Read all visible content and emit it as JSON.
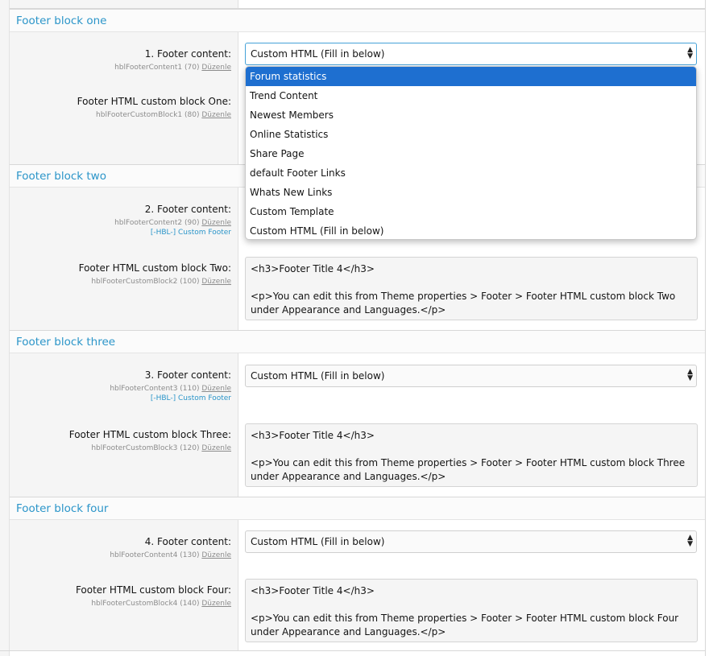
{
  "blocks": [
    {
      "title": "Footer block one",
      "content_label": "1. Footer content:",
      "content_var": "hblFooterContent1 (70)",
      "custom_label": "Footer HTML custom block One:",
      "custom_var": "hblFooterCustomBlock1 (80)",
      "select_value": "Custom HTML (Fill in below)"
    },
    {
      "title": "Footer block two",
      "content_label": "2. Footer content:",
      "content_var": "hblFooterContent2 (90)",
      "content_link": "[-HBL-] Custom Footer",
      "custom_label": "Footer HTML custom block Two:",
      "custom_var": "hblFooterCustomBlock2 (100)",
      "textarea": "<h3>Footer Title 4</h3>\n\n<p>You can edit this from Theme properties > Footer > Footer HTML custom block Two under Appearance and Languages.</p>"
    },
    {
      "title": "Footer block three",
      "content_label": "3. Footer content:",
      "content_var": "hblFooterContent3 (110)",
      "content_link": "[-HBL-] Custom Footer",
      "custom_label": "Footer HTML custom block Three:",
      "custom_var": "hblFooterCustomBlock3 (120)",
      "select_value": "Custom HTML (Fill in below)",
      "textarea": "<h3>Footer Title 4</h3>\n\n<p>You can edit this from Theme properties > Footer > Footer HTML custom block Three under Appearance and Languages.</p>"
    },
    {
      "title": "Footer block four",
      "content_label": "4. Footer content:",
      "content_var": "hblFooterContent4 (130)",
      "custom_label": "Footer HTML custom block Four:",
      "custom_var": "hblFooterCustomBlock4 (140)",
      "select_value": "Custom HTML (Fill in below)",
      "textarea": "<h3>Footer Title 4</h3>\n\n<p>You can edit this from Theme properties > Footer > Footer HTML custom block Four under Appearance and Languages.</p>"
    }
  ],
  "edit_link": "Düzenle",
  "dropdown_options": [
    "Forum statistics",
    "Trend Content",
    "Newest Members",
    "Online Statistics",
    "Share Page",
    "default Footer Links",
    "Whats New Links",
    "Custom Template",
    "Custom HTML (Fill in below)"
  ],
  "dropdown_highlighted": "Forum statistics",
  "colors": {
    "accent": "#2b95c9",
    "highlight": "#1e6fd0",
    "label_bg": "#f5f5f5"
  },
  "icons": {
    "select_arrow": "select-arrows-icon"
  }
}
